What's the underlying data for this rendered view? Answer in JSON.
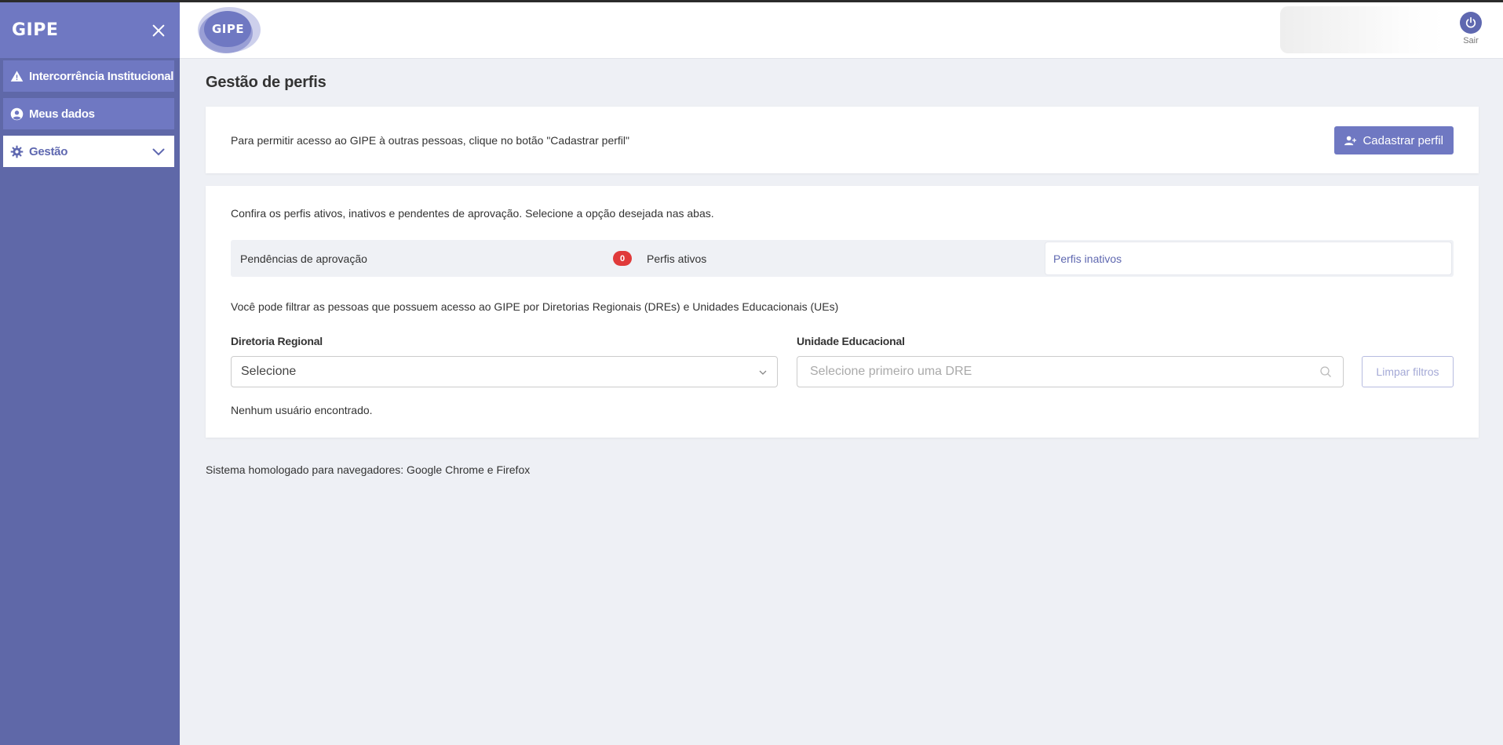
{
  "sidebar": {
    "logo": "GIPE",
    "items": [
      {
        "label": "Intercorrência Institucional"
      },
      {
        "label": "Meus dados"
      },
      {
        "label": "Gestão"
      }
    ]
  },
  "header": {
    "logo": "GIPE",
    "logout_label": "Sair"
  },
  "main": {
    "title": "Gestão de perfis",
    "register_card": {
      "text": "Para permitir acesso ao GIPE à outras pessoas, clique no botão \"Cadastrar perfil\"",
      "button_label": "Cadastrar perfil"
    },
    "profiles_card": {
      "intro": "Confira os perfis ativos, inativos e pendentes de aprovação. Selecione a opção desejada nas abas.",
      "tabs": [
        {
          "label": "Pendências de aprovação",
          "badge": "0"
        },
        {
          "label": "Perfis ativos"
        },
        {
          "label": "Perfis inativos",
          "active": true
        }
      ],
      "filter_text": "Você pode filtrar as pessoas que possuem acesso ao GIPE por Diretorias Regionais (DREs) e Unidades Educacionais (UEs)",
      "dre_label": "Diretoria Regional",
      "dre_value": "Selecione",
      "ue_label": "Unidade Educacional",
      "ue_placeholder": "Selecione primeiro uma DRE",
      "clear_button": "Limpar filtros",
      "empty_message": "Nenhum usuário encontrado."
    },
    "footer_note": "Sistema homologado para navegadores: Google Chrome e Firefox"
  },
  "colors": {
    "sidebar_bg": "#5f68a8",
    "sidebar_item_bg": "#6f78c2",
    "accent": "#6f78c2",
    "badge": "#e03a3a",
    "page_bg": "#eef0f5"
  },
  "icons": {
    "sidebar_items": [
      "warning-icon",
      "user-circle-icon",
      "gear-icon"
    ],
    "close": "close-icon",
    "logout": "power-icon",
    "register": "user-plus-icon",
    "search": "search-icon"
  }
}
